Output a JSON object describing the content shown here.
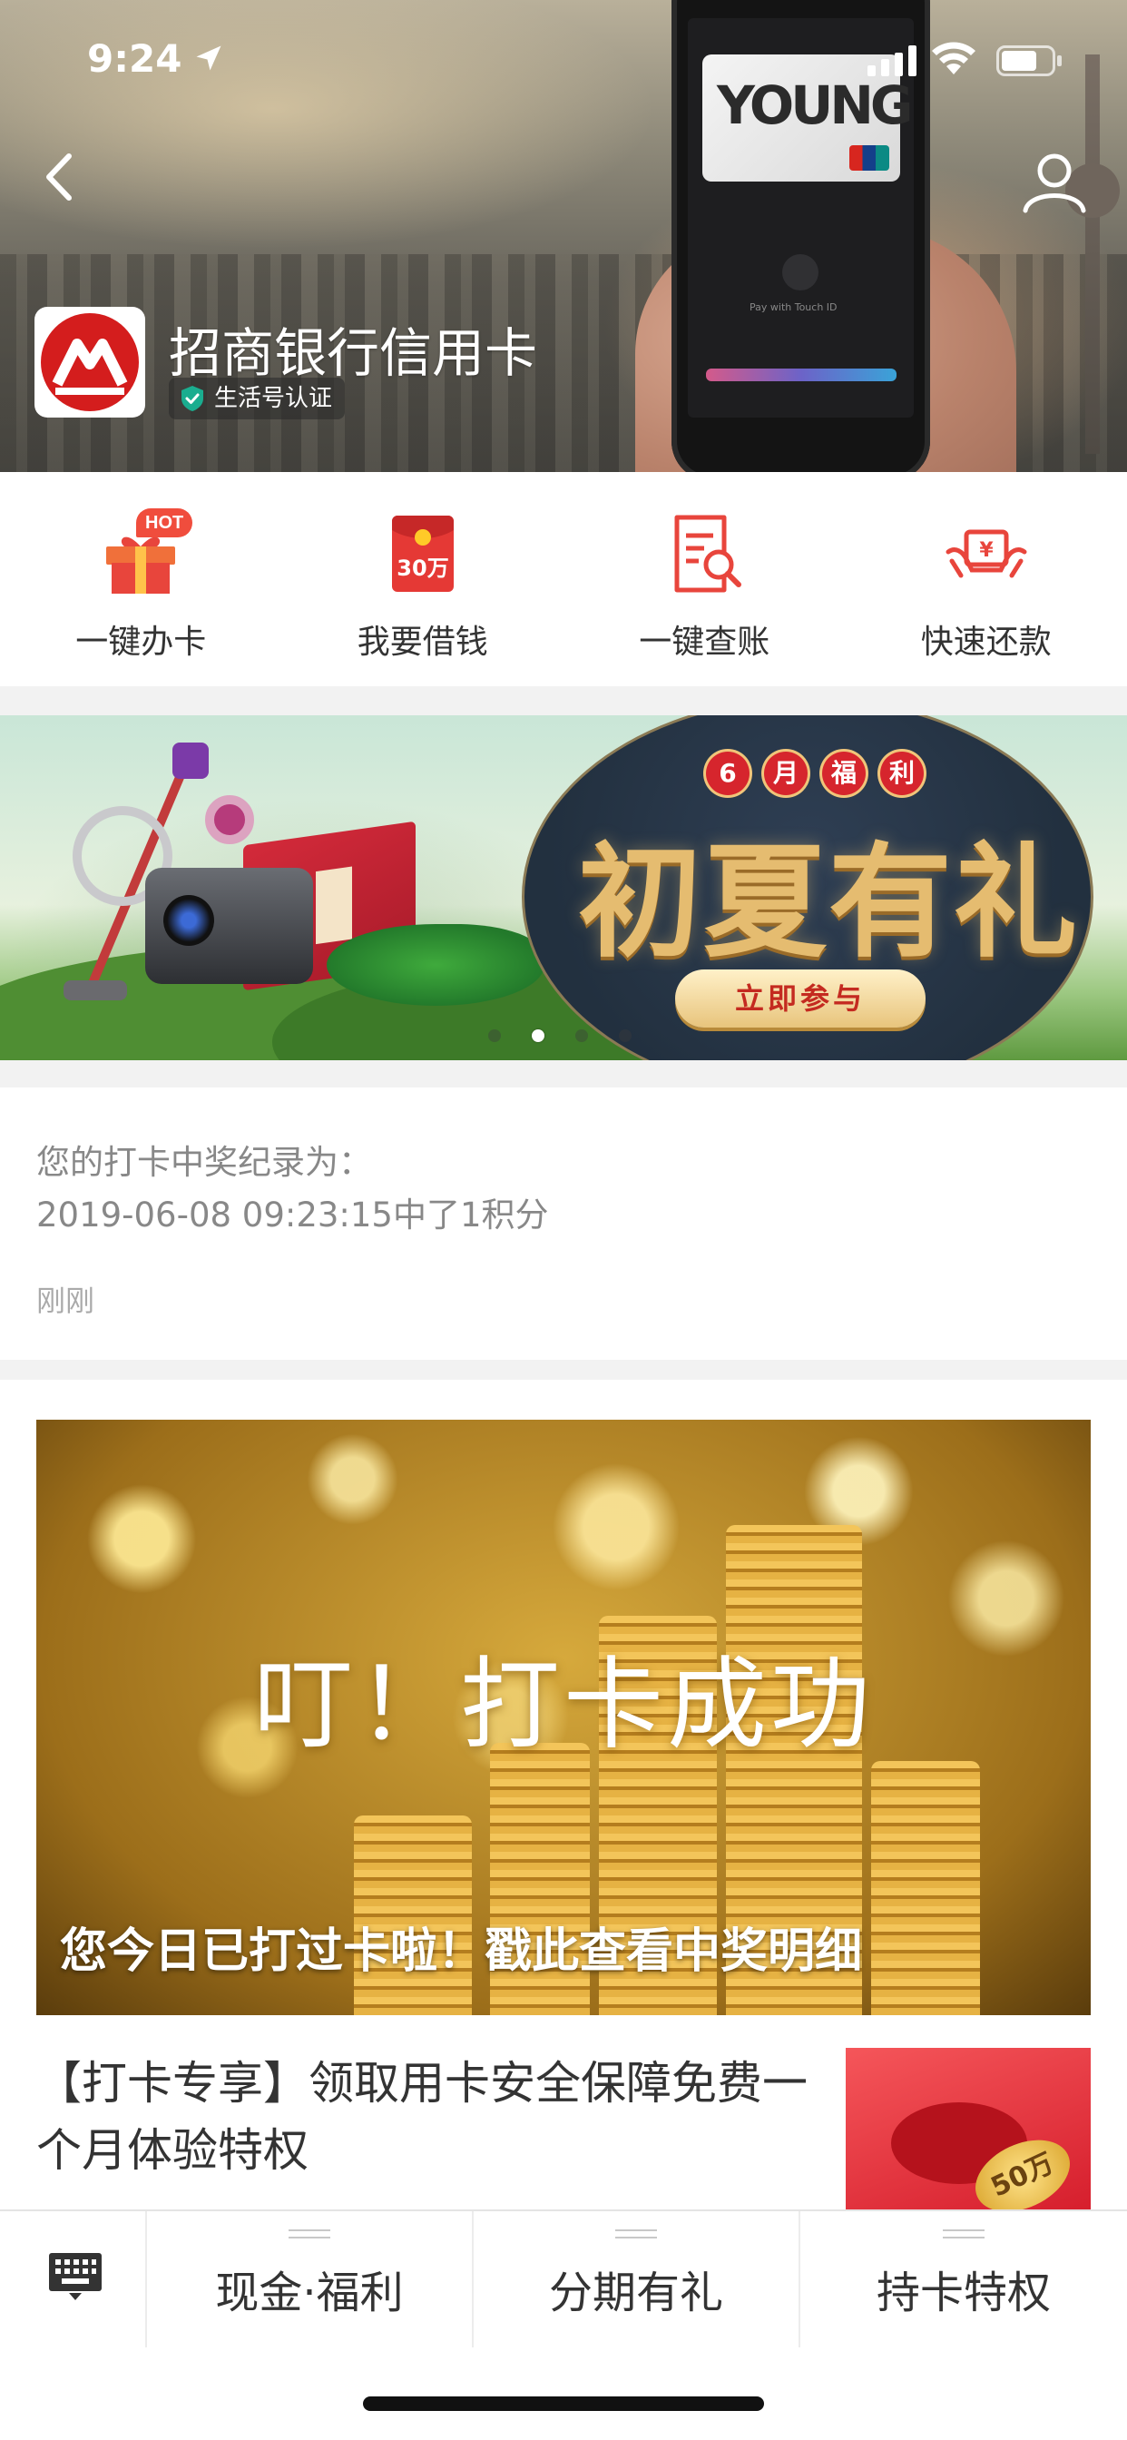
{
  "status_bar": {
    "time": "9:24"
  },
  "account": {
    "name": "招商银行信用卡",
    "verification_badge": "生活号认证"
  },
  "hero_phone": {
    "card_text": "YOUNG",
    "pay_text": "Pay with Touch ID"
  },
  "quick_actions": [
    {
      "label": "一键办卡",
      "icon": "gift-icon",
      "badge": "HOT"
    },
    {
      "label": "我要借钱",
      "icon": "red-envelope-icon",
      "icon_text": "30万"
    },
    {
      "label": "一键查账",
      "icon": "bill-search-icon"
    },
    {
      "label": "快速还款",
      "icon": "repayment-icon"
    }
  ],
  "banner": {
    "month_chars": [
      "6",
      "月",
      "福",
      "利"
    ],
    "headline": "初夏有礼",
    "cta": "立即参与",
    "slide_count": 4,
    "active_slide": 1
  },
  "checkin_record": {
    "line1": "您的打卡中奖纪录为：",
    "line2": "2019-06-08 09:23:15中了1积分",
    "timestamp": "刚刚"
  },
  "article": {
    "feature_title": "叮！打卡成功",
    "feature_caption": "您今日已打过卡啦！戳此查看中奖明细",
    "promo_title": "【打卡专享】领取用卡安全保障免费一个月体验特权",
    "promo_thumb_text": "50万"
  },
  "tab_bar": {
    "tabs": [
      {
        "label": "现金·福利"
      },
      {
        "label": "分期有礼"
      },
      {
        "label": "持卡特权"
      }
    ]
  },
  "colors": {
    "brand_red": "#d41d1d",
    "icon_red": "#e8453c",
    "banner_navy": "#22303f",
    "banner_gold": "#e5bc70"
  }
}
